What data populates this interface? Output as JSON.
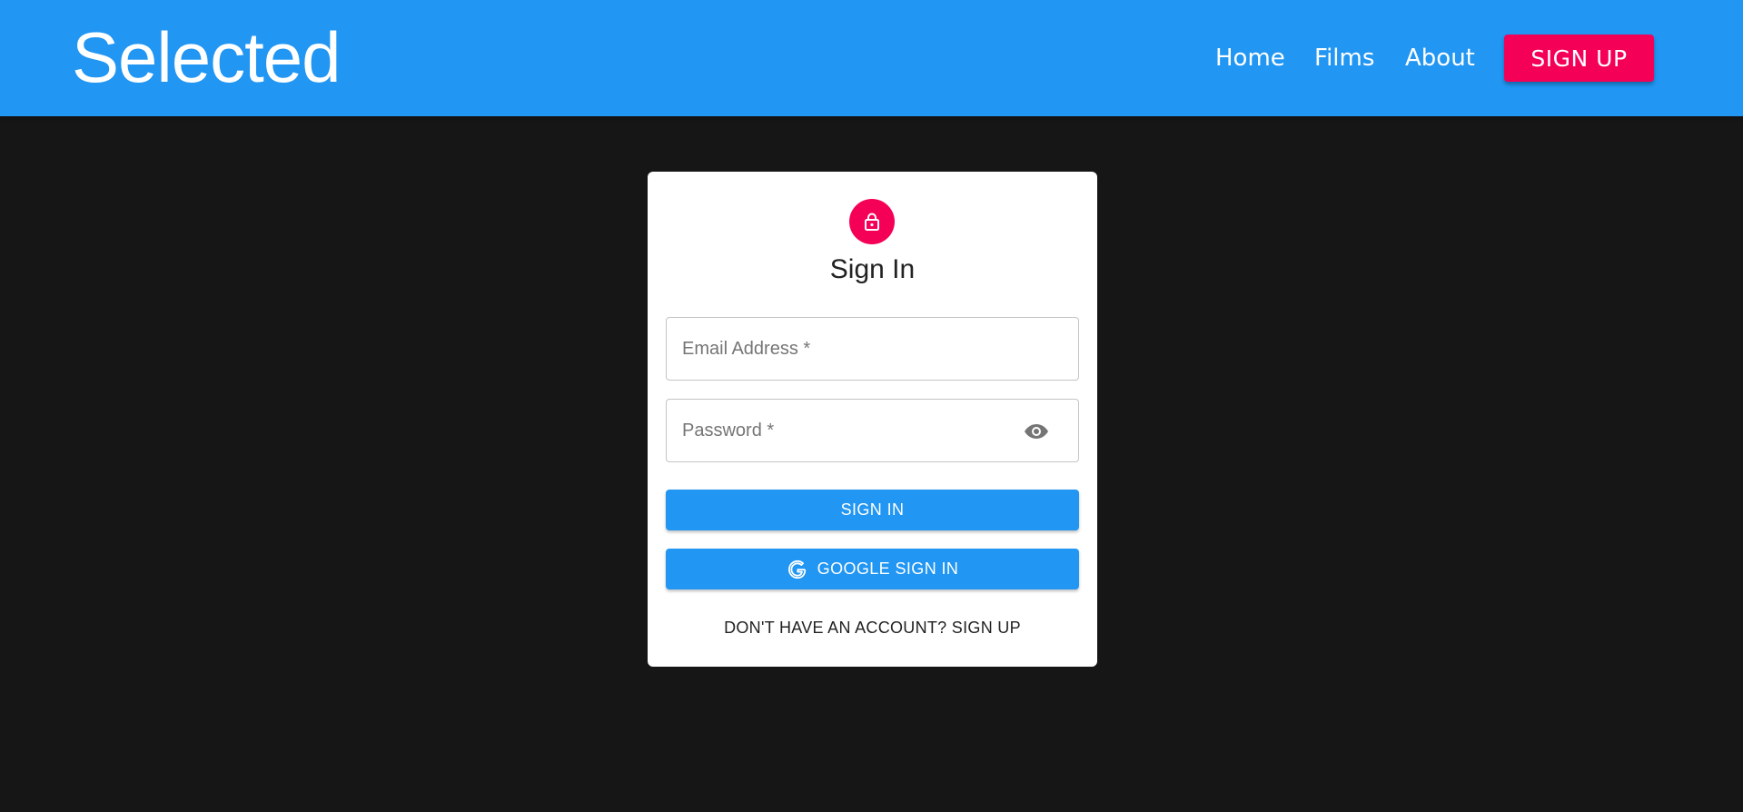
{
  "header": {
    "brand": "Selected",
    "nav": {
      "home": "Home",
      "films": "Films",
      "about": "About"
    },
    "signup_label": "SIGN UP",
    "icons": {
      "header_background": "#2196f3",
      "signup_background": "#f50057"
    }
  },
  "card": {
    "lock_icon": "lock-outline-icon",
    "title": "Sign In",
    "email": {
      "value": "",
      "placeholder": "Email Address *"
    },
    "password": {
      "value": "",
      "placeholder": "Password *",
      "toggle_icon": "eye-icon"
    },
    "signin_label": "SIGN IN",
    "google_label": "GOOGLE SIGN IN",
    "google_icon": "google-g-icon",
    "signup_link": "DON'T HAVE AN ACCOUNT? SIGN UP"
  },
  "colors": {
    "background": "#161616",
    "primary": "#2196f3",
    "accent": "#f50057"
  }
}
